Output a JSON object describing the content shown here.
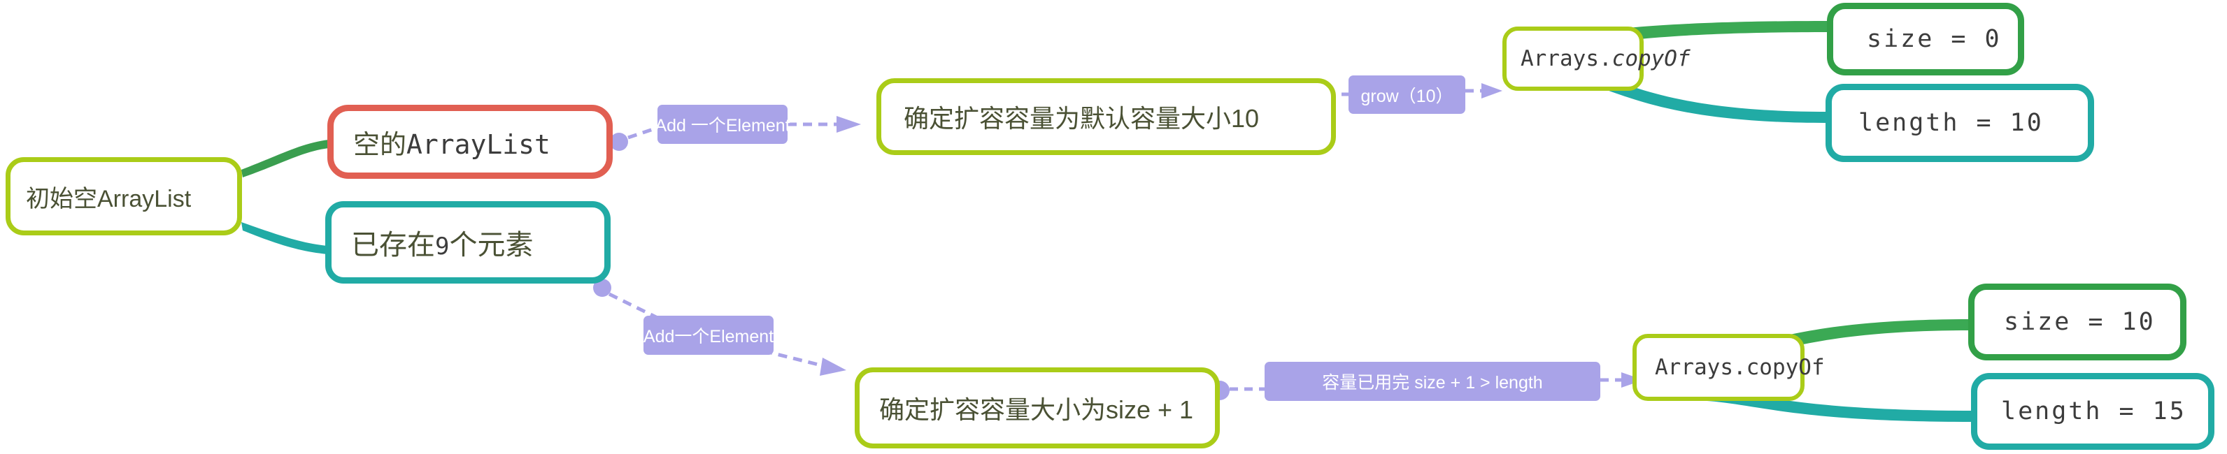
{
  "diagram": {
    "title_node": "初始空ArrayList",
    "nodes": {
      "root": {
        "label": "初始空ArrayList",
        "color": "#aacc18"
      },
      "empty_list": {
        "label_han": "空的",
        "label_mono": "ArrayList",
        "color": "#e15f52"
      },
      "nine_elements": {
        "label_han_a": "已存在",
        "label_mono": "9",
        "label_han_b": "个元素",
        "color": "#21aba5"
      },
      "grow_default": {
        "label": "确定扩容容量为默认容量大小10",
        "color": "#aacc18"
      },
      "grow_size_plus_one": {
        "label": "确定扩容容量大小为size + 1",
        "color": "#aacc18"
      },
      "copyof_top": {
        "label_plain": "Arrays.",
        "label_italic": "copyOf",
        "color": "#aacc18"
      },
      "copyof_bottom": {
        "label": "Arrays.copyOf",
        "color": "#aacc18"
      },
      "size_top": {
        "label": "size = 0",
        "color": "#32a047"
      },
      "length_top": {
        "label": "length  = 10",
        "color": "#21aba5"
      },
      "size_bottom": {
        "label": "size = 10",
        "color": "#32a047"
      },
      "length_bottom": {
        "label": "length = 15",
        "color": "#21aba5"
      }
    },
    "edge_labels": {
      "add_element_top": "Add 一个Element",
      "grow_10": "grow（10）",
      "add_element_bottom": "Add一个Element",
      "capacity_full": "容量已用完 size + 1 > length"
    },
    "colors": {
      "lime": "#aacc18",
      "red": "#e15f52",
      "teal": "#21aba5",
      "green": "#32a047",
      "purple": "#a9a3e8",
      "text": "#4a5134",
      "mono_text": "#3c3c3c",
      "background": "#ffffff"
    }
  }
}
